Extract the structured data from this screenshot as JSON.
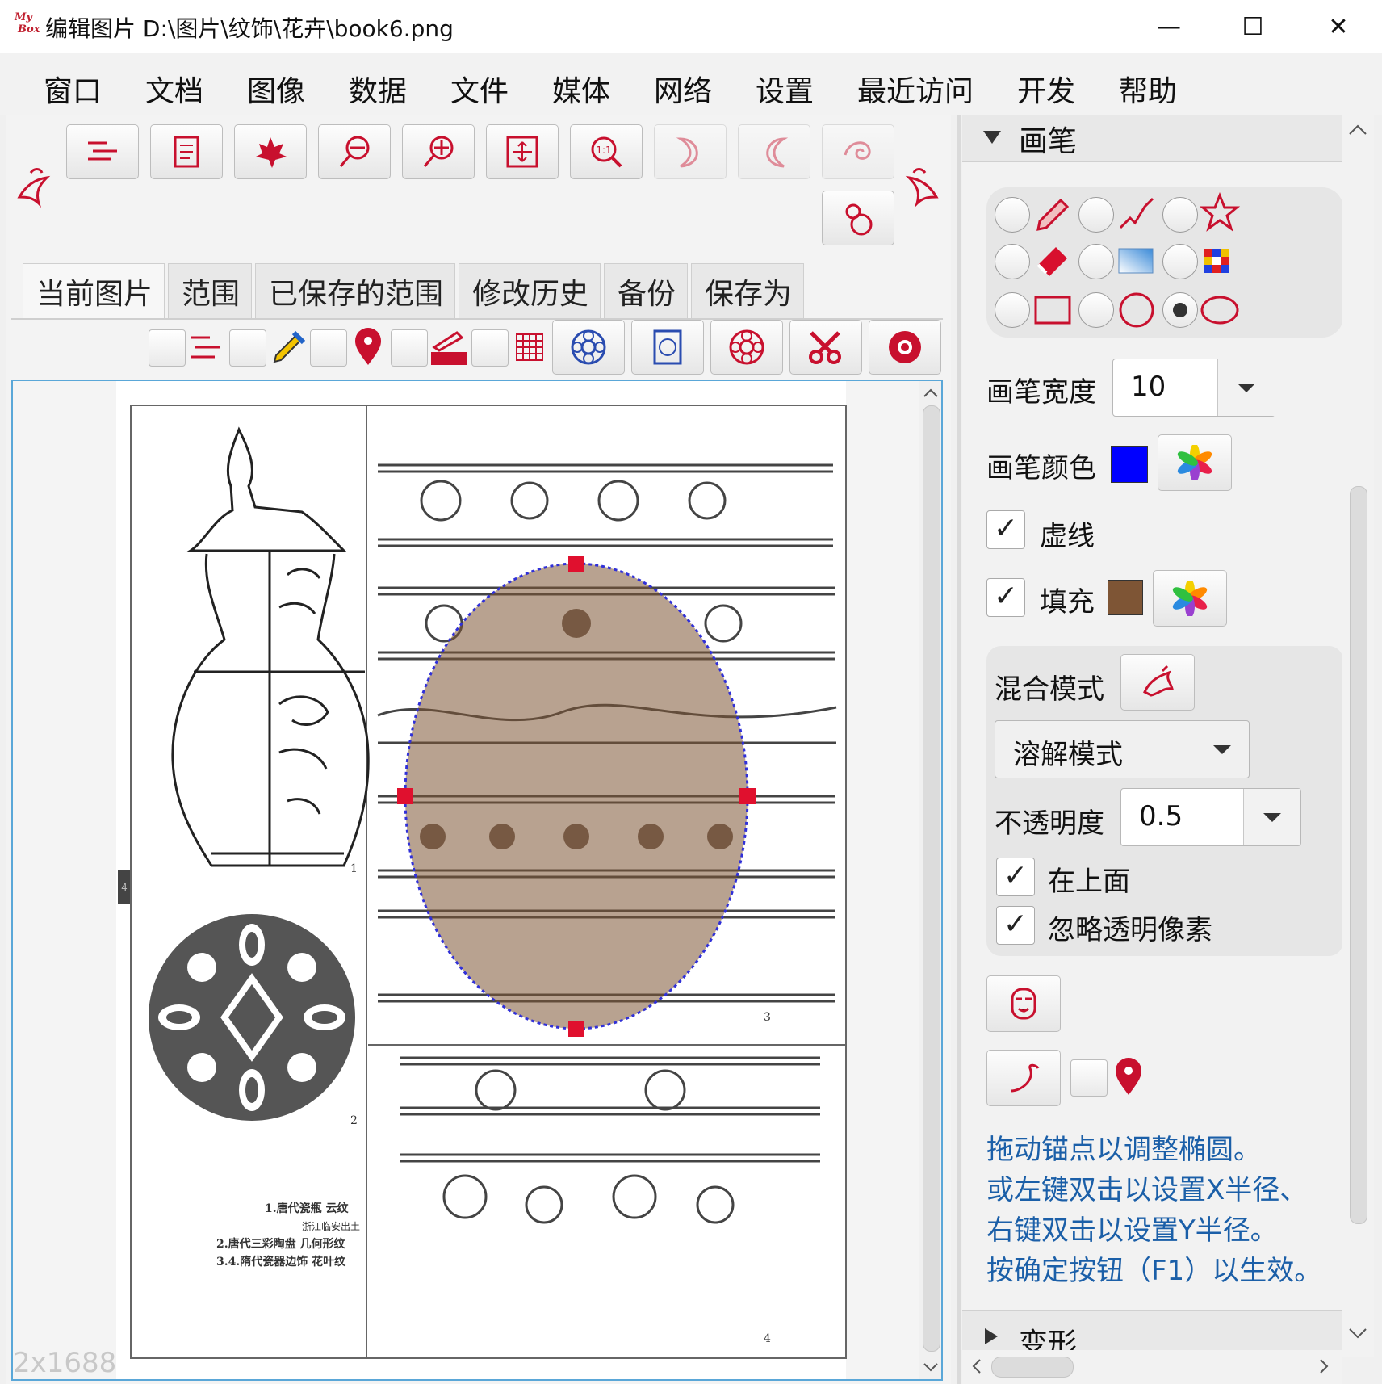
{
  "window": {
    "app_logo_line1": "My",
    "app_logo_line2": "Box",
    "title": "编辑图片 D:\\图片\\纹饰\\花卉\\book6.png",
    "minimize": "—",
    "maximize": "☐",
    "close": "✕"
  },
  "menu": [
    "窗口",
    "文档",
    "图像",
    "数据",
    "文件",
    "媒体",
    "网络",
    "设置",
    "最近访问",
    "开发",
    "帮助"
  ],
  "tabs": [
    "当前图片",
    "范围",
    "已保存的范围",
    "修改历史",
    "备份",
    "保存为"
  ],
  "canvas": {
    "size_label": "2x1688",
    "side_marker": "4",
    "captions": {
      "fig1_num": "1",
      "fig2_num": "2",
      "fig3_num": "3",
      "fig4_num": "4",
      "caption_line1": "1.唐代瓷瓶    云纹",
      "caption_line2": "浙江临安出土",
      "caption_line3": "2.唐代三彩陶盘    几何形纹",
      "caption_line4": "3.4.隋代瓷器边饰    花叶纹"
    }
  },
  "brush_panel": {
    "section_title": "画笔",
    "width_label": "画笔宽度",
    "width_value": "10",
    "color_label": "画笔颜色",
    "stroke_color": "#0000ff",
    "dashed_label": "虚线",
    "dashed_checked": "✓",
    "fill_label": "填充",
    "fill_checked": "✓",
    "fill_color": "#7e5535",
    "blend_label": "混合模式",
    "blend_mode": "溶解模式",
    "opacity_label": "不透明度",
    "opacity_value": "0.5",
    "on_top_label": "在上面",
    "on_top_checked": "✓",
    "ignore_transparent_label": "忽略透明像素",
    "ignore_transparent_checked": "✓",
    "selected_shape": "ellipse"
  },
  "hint": {
    "line1": "拖动锚点以调整椭圆。",
    "line2": "或左键双击以设置X半径、",
    "line3": "右键双击以设置Y半径。",
    "line4": "按确定按钮（F1）以生效。"
  },
  "next_section": "变形",
  "colors": {
    "accent_red": "#c8102e",
    "hint_blue": "#1b5fa8",
    "frame_blue": "#5aa7d8"
  }
}
